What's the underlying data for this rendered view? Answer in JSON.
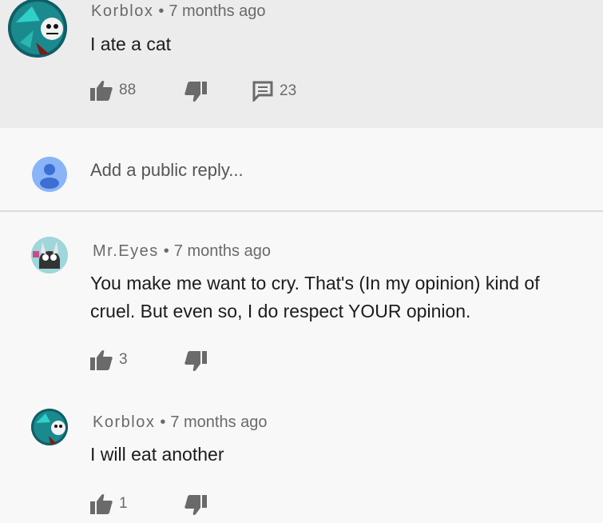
{
  "comments": [
    {
      "author": "Korblox",
      "time": "7 months ago",
      "text": "I ate a cat",
      "likes": "88",
      "replies": "23"
    },
    {
      "author": "Mr.Eyes",
      "time": "7 months ago",
      "text": "You make me want to cry. That's (In my opinion) kind of cruel. But even so, I do respect YOUR opinion.",
      "likes": "3"
    },
    {
      "author": "Korblox",
      "time": "7 months ago",
      "text": "I will eat another",
      "likes": "1"
    }
  ],
  "reply_box": {
    "placeholder": "Add a public reply..."
  },
  "separator": "•",
  "colors": {
    "meta_text": "#6a6a6a",
    "highlight_bg": "#ececec",
    "page_bg": "#f8f8f8",
    "reply_avatar": "#8ab4f8"
  }
}
